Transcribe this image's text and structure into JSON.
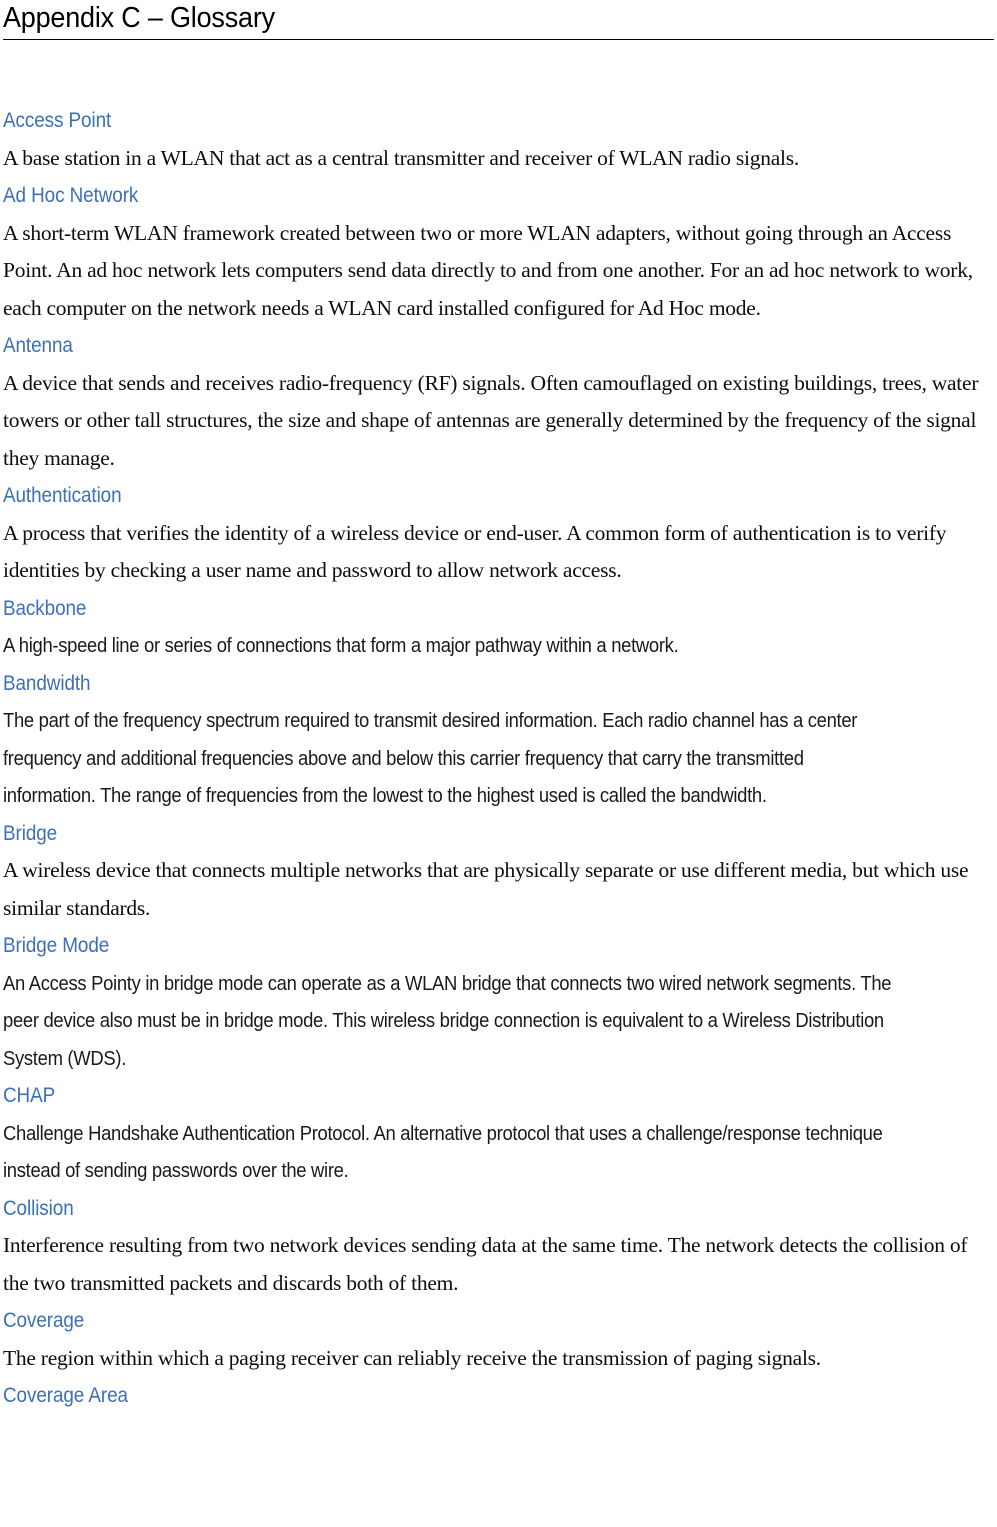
{
  "document": {
    "title": "Appendix C – Glossary"
  },
  "glossary": {
    "entries": [
      {
        "term": "Access Point",
        "definition": "A base station in a WLAN that act as a central transmitter and receiver of WLAN radio signals.",
        "font": "serif"
      },
      {
        "term": "Ad Hoc Network",
        "definition": "A short-term WLAN framework created between two or more WLAN adapters, without going through an Access Point. An ad hoc network lets computers send data directly to and from one another. For an ad hoc network to work, each computer on the network needs a WLAN card installed configured for Ad Hoc mode.",
        "font": "serif"
      },
      {
        "term": "Antenna",
        "definition": "A device that sends and receives radio-frequency (RF) signals. Often camouflaged on existing buildings, trees, water towers or other tall structures, the size and shape of antennas are generally determined by the frequency of the signal they manage.",
        "font": "serif"
      },
      {
        "term": "Authentication",
        "definition": "A process that verifies the identity of a wireless device or end-user. A common form of authentication is to verify identities by checking a user name and password to allow network access.",
        "font": "serif"
      },
      {
        "term": "Backbone",
        "definition": "A high-speed line or series of connections that form a major  pathway within a network.",
        "font": "sans"
      },
      {
        "term": "Bandwidth",
        "definition": "The part of the frequency spectrum required to transmit desired information. Each radio  channel has a center frequency and additional frequencies above and below this carrier frequency that carry the transmitted information. The range of frequencies from the lowest to the highest used is called the bandwidth.",
        "font": "sans"
      },
      {
        "term": "Bridge",
        "definition": "A wireless device that connects multiple networks that are physically separate or use different media, but which use similar standards.",
        "font": "serif"
      },
      {
        "term": "Bridge Mode",
        "definition": "An Access Pointy in bridge mode can operate as a WLAN bridge  that connects two wired network segments. The peer device also must be in bridge mode.  This wireless bridge connection is equivalent to a Wireless Distribution System (WDS).",
        "font": "sans"
      },
      {
        "term": "CHAP",
        "definition": "Challenge Handshake Authentication Protocol. An alternative protocol that uses a challenge/response technique instead of sending passwords over the wire.",
        "font": "sans"
      },
      {
        "term": "Collision",
        "definition": "Interference resulting from two network devices sending data at the same time. The network detects the collision of the two transmitted packets and discards both of them.",
        "font": "serif"
      },
      {
        "term": "Coverage",
        "definition": "The region within which a paging receiver can reliably receive the transmission of paging signals.",
        "font": "serif"
      },
      {
        "term": "Coverage Area",
        "definition": "",
        "font": "serif"
      }
    ]
  },
  "colors": {
    "term_blue": "#3E70B5",
    "body_black": "#0d0d0d",
    "page_background": "#ffffff",
    "rule": "#000000"
  }
}
